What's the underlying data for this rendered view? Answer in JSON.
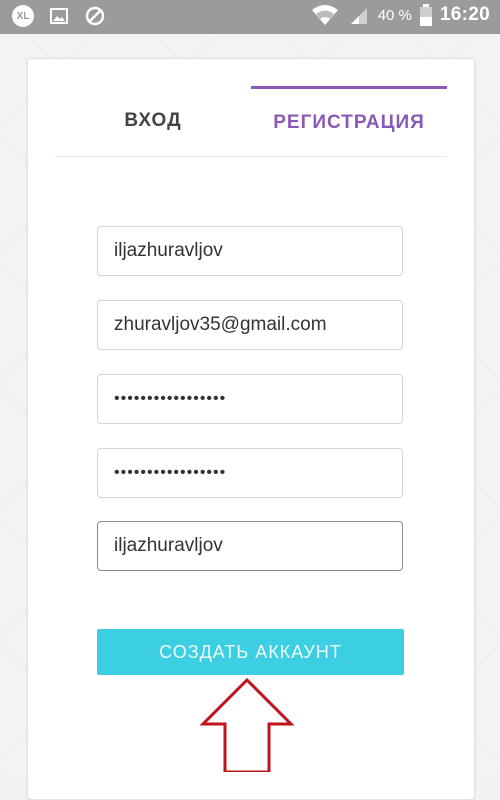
{
  "status_bar": {
    "carrier_badge": "XL",
    "icons": [
      "xl-badge-icon",
      "image-notification-icon",
      "blocked-icon",
      "wifi-icon",
      "signal-icon",
      "battery-icon"
    ],
    "battery": "40 %",
    "time": "16:20"
  },
  "tabs": {
    "login": "ВХОД",
    "register": "РЕГИСТРАЦИЯ",
    "active": "register"
  },
  "form": {
    "username": "iljazhuravljov",
    "email": "zhuravljov35@gmail.com",
    "password": "•••••••••••••••••",
    "password_confirm": "•••••••••••••••••",
    "display_name": "iljazhuravljov"
  },
  "submit_label": "СОЗДАТЬ АККАУНТ",
  "colors": {
    "accent_purple": "#8a58b7",
    "button_cyan": "#3ccfe3",
    "arrow_red": "#c0141c",
    "status_bar": "#9b9b9b"
  }
}
